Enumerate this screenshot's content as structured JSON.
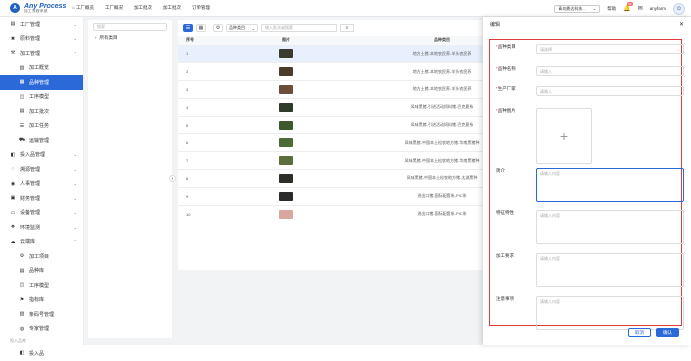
{
  "app": {
    "logo_title": "Any Process",
    "logo_sub": "加工流程系统",
    "logo_mark": "A"
  },
  "topnav": [
    {
      "label": "工厂概览",
      "icon": "home-icon"
    },
    {
      "label": "工厂概况"
    },
    {
      "label": "加工批次"
    },
    {
      "label": "加工批次"
    },
    {
      "label": "订单管理"
    }
  ],
  "topright": {
    "selector": "青岛鼎达科技...",
    "help": "帮助",
    "notif_badge": "52",
    "user": "anyfarm"
  },
  "sidebar": [
    {
      "label": "工厂管理",
      "type": "top",
      "icon": "factory-icon"
    },
    {
      "label": "原料管理",
      "type": "top",
      "icon": "cross-tools-icon"
    },
    {
      "label": "加工管理",
      "type": "top",
      "icon": "hammer-icon",
      "open": true
    },
    {
      "label": "加工概览",
      "type": "sub",
      "icon": "chart-icon"
    },
    {
      "label": "品种管理",
      "type": "sub",
      "icon": "grid-icon",
      "active": true
    },
    {
      "label": "工序模型",
      "type": "sub",
      "icon": "model-icon"
    },
    {
      "label": "加工批次",
      "type": "sub",
      "icon": "batch-icon"
    },
    {
      "label": "加工任务",
      "type": "sub",
      "icon": "task-icon"
    },
    {
      "label": "运输管理",
      "type": "sub",
      "icon": "truck-icon"
    },
    {
      "label": "投入品管理",
      "type": "top",
      "icon": "input-icon"
    },
    {
      "label": "溯源管理",
      "type": "top",
      "icon": "trace-icon"
    },
    {
      "label": "人事管理",
      "type": "top",
      "icon": "person-icon"
    },
    {
      "label": "财务管理",
      "type": "top",
      "icon": "finance-icon"
    },
    {
      "label": "设备管理",
      "type": "top",
      "icon": "device-icon"
    },
    {
      "label": "环境监测",
      "type": "top",
      "icon": "env-icon"
    },
    {
      "label": "云端库",
      "type": "top",
      "icon": "cloud-icon",
      "open": true
    },
    {
      "label": "加工项目",
      "type": "sub",
      "icon": "gear-icon"
    },
    {
      "label": "品种库",
      "type": "sub",
      "icon": "library-icon"
    },
    {
      "label": "工序模型",
      "type": "sub",
      "icon": "model-icon"
    },
    {
      "label": "指标库",
      "type": "sub",
      "icon": "flag-icon"
    },
    {
      "label": "条码号管理",
      "type": "sub",
      "icon": "barcode-icon"
    },
    {
      "label": "专家管理",
      "type": "sub",
      "icon": "expert-icon"
    },
    {
      "label": "投入品库",
      "type": "section"
    },
    {
      "label": "投入品",
      "type": "sub",
      "icon": "input-icon"
    }
  ],
  "tree": {
    "search_placeholder": "搜索",
    "root": "所有类目"
  },
  "toolbar": {
    "filter_value": "品种类目",
    "search_placeholder": "输入批次或搜索"
  },
  "table": {
    "headers": [
      "序号",
      "图片",
      "品种类目"
    ],
    "rows": [
      {
        "no": "1",
        "category": "地方土猪-本地农民养-羊头农民养",
        "color": "#3a3a2e",
        "highlight": true
      },
      {
        "no": "2",
        "category": "地方土猪-本地农民养-羊头农民养",
        "color": "#4a3b2a"
      },
      {
        "no": "3",
        "category": "地方土猪-本地农民养-羊头农民养",
        "color": "#6b4f3a"
      },
      {
        "no": "4",
        "category": "风味黑猪-引进活动饲料猪-巴克夏系",
        "color": "#2f3b2c"
      },
      {
        "no": "5",
        "category": "风味黑猪-引进活动饲料猪-巴克夏系",
        "color": "#3d5a2f"
      },
      {
        "no": "6",
        "category": "风味黑猪-中国本土松农地方猪-华南黑猪种",
        "color": "#4d6b34"
      },
      {
        "no": "7",
        "category": "风味黑猪-中国本土松农地方猪-华南黑猪种",
        "color": "#5c6e3a"
      },
      {
        "no": "8",
        "category": "风味黑猪-中国本土松农地方猪-太湖黑种",
        "color": "#2e2e28"
      },
      {
        "no": "9",
        "category": "进出口猪-国际配套系-PIC系",
        "color": "#2a2a2a"
      },
      {
        "no": "10",
        "category": "进出口猪-国际配套系-PIC系",
        "color": "#d9a7a0"
      }
    ]
  },
  "drawer": {
    "title": "编辑",
    "fields": [
      {
        "label": "品种类目",
        "required": true,
        "placeholder": "请选择",
        "kind": "select"
      },
      {
        "label": "品种名称",
        "required": true,
        "placeholder": "请输入",
        "kind": "input"
      },
      {
        "label": "生产厂家",
        "required": true,
        "placeholder": "请输入",
        "kind": "input"
      },
      {
        "label": "品种图片",
        "required": true,
        "placeholder": "+",
        "kind": "upload"
      },
      {
        "label": "简介",
        "required": false,
        "placeholder": "请输入内容",
        "kind": "textarea",
        "focus": true
      },
      {
        "label": "特征特性",
        "required": false,
        "placeholder": "请输入内容",
        "kind": "textarea"
      },
      {
        "label": "加工要求",
        "required": false,
        "placeholder": "请输入内容",
        "kind": "textarea"
      },
      {
        "label": "注意事项",
        "required": false,
        "placeholder": "请输入内容",
        "kind": "textarea"
      }
    ],
    "cancel": "取消",
    "confirm": "确认"
  },
  "colors": {
    "accent": "#2b69d9",
    "highlight_border": "#e03b3b"
  }
}
